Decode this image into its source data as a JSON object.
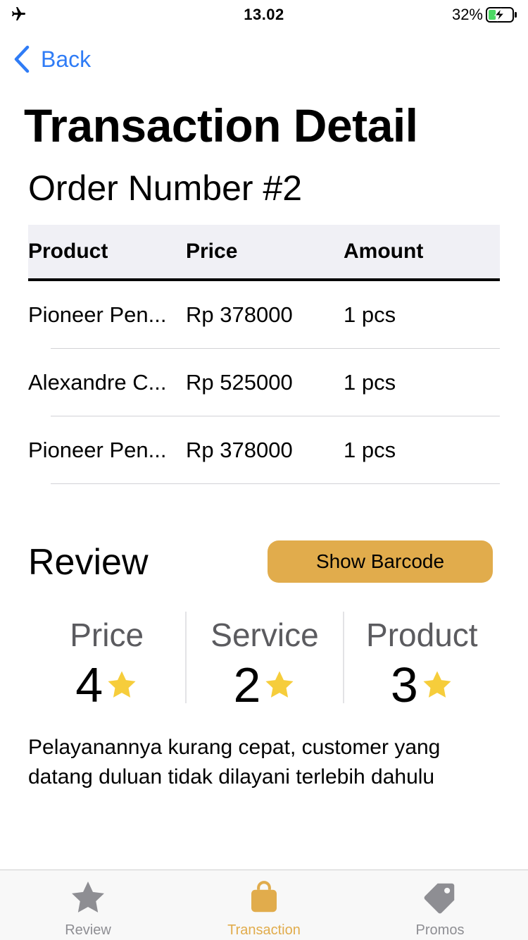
{
  "status_bar": {
    "time": "13.02",
    "battery_percent": "32%",
    "battery_level": 0.32,
    "icons": [
      "airplane-icon",
      "battery-charging-icon"
    ]
  },
  "nav": {
    "back_label": "Back",
    "back_icon": "chevron-left-icon"
  },
  "page": {
    "title": "Transaction Detail",
    "order_number": "Order Number #2"
  },
  "table": {
    "headers": [
      "Product",
      "Price",
      "Amount"
    ],
    "rows": [
      {
        "product": "Pioneer Pen...",
        "price": "Rp 378000",
        "amount": "1 pcs"
      },
      {
        "product": "Alexandre C...",
        "price": "Rp 525000",
        "amount": "1 pcs"
      },
      {
        "product": "Pioneer Pen...",
        "price": "Rp 378000",
        "amount": "1 pcs"
      }
    ]
  },
  "review": {
    "title": "Review",
    "barcode_button": "Show Barcode",
    "ratings": [
      {
        "label": "Price",
        "value": "4"
      },
      {
        "label": "Service",
        "value": "2"
      },
      {
        "label": "Product",
        "value": "3"
      }
    ],
    "comment": "Pelayanannya kurang cepat, customer yang datang duluan tidak dilayani terlebih dahulu"
  },
  "tabbar": {
    "tabs": [
      {
        "label": "Review",
        "icon": "star-icon",
        "active": false
      },
      {
        "label": "Transaction",
        "icon": "bag-icon",
        "active": true
      },
      {
        "label": "Promos",
        "icon": "tag-icon",
        "active": false
      }
    ]
  },
  "colors": {
    "accent": "#e1ac4c",
    "link": "#2f7cf6",
    "star": "#f6cd3b",
    "battery": "#4cd964"
  }
}
